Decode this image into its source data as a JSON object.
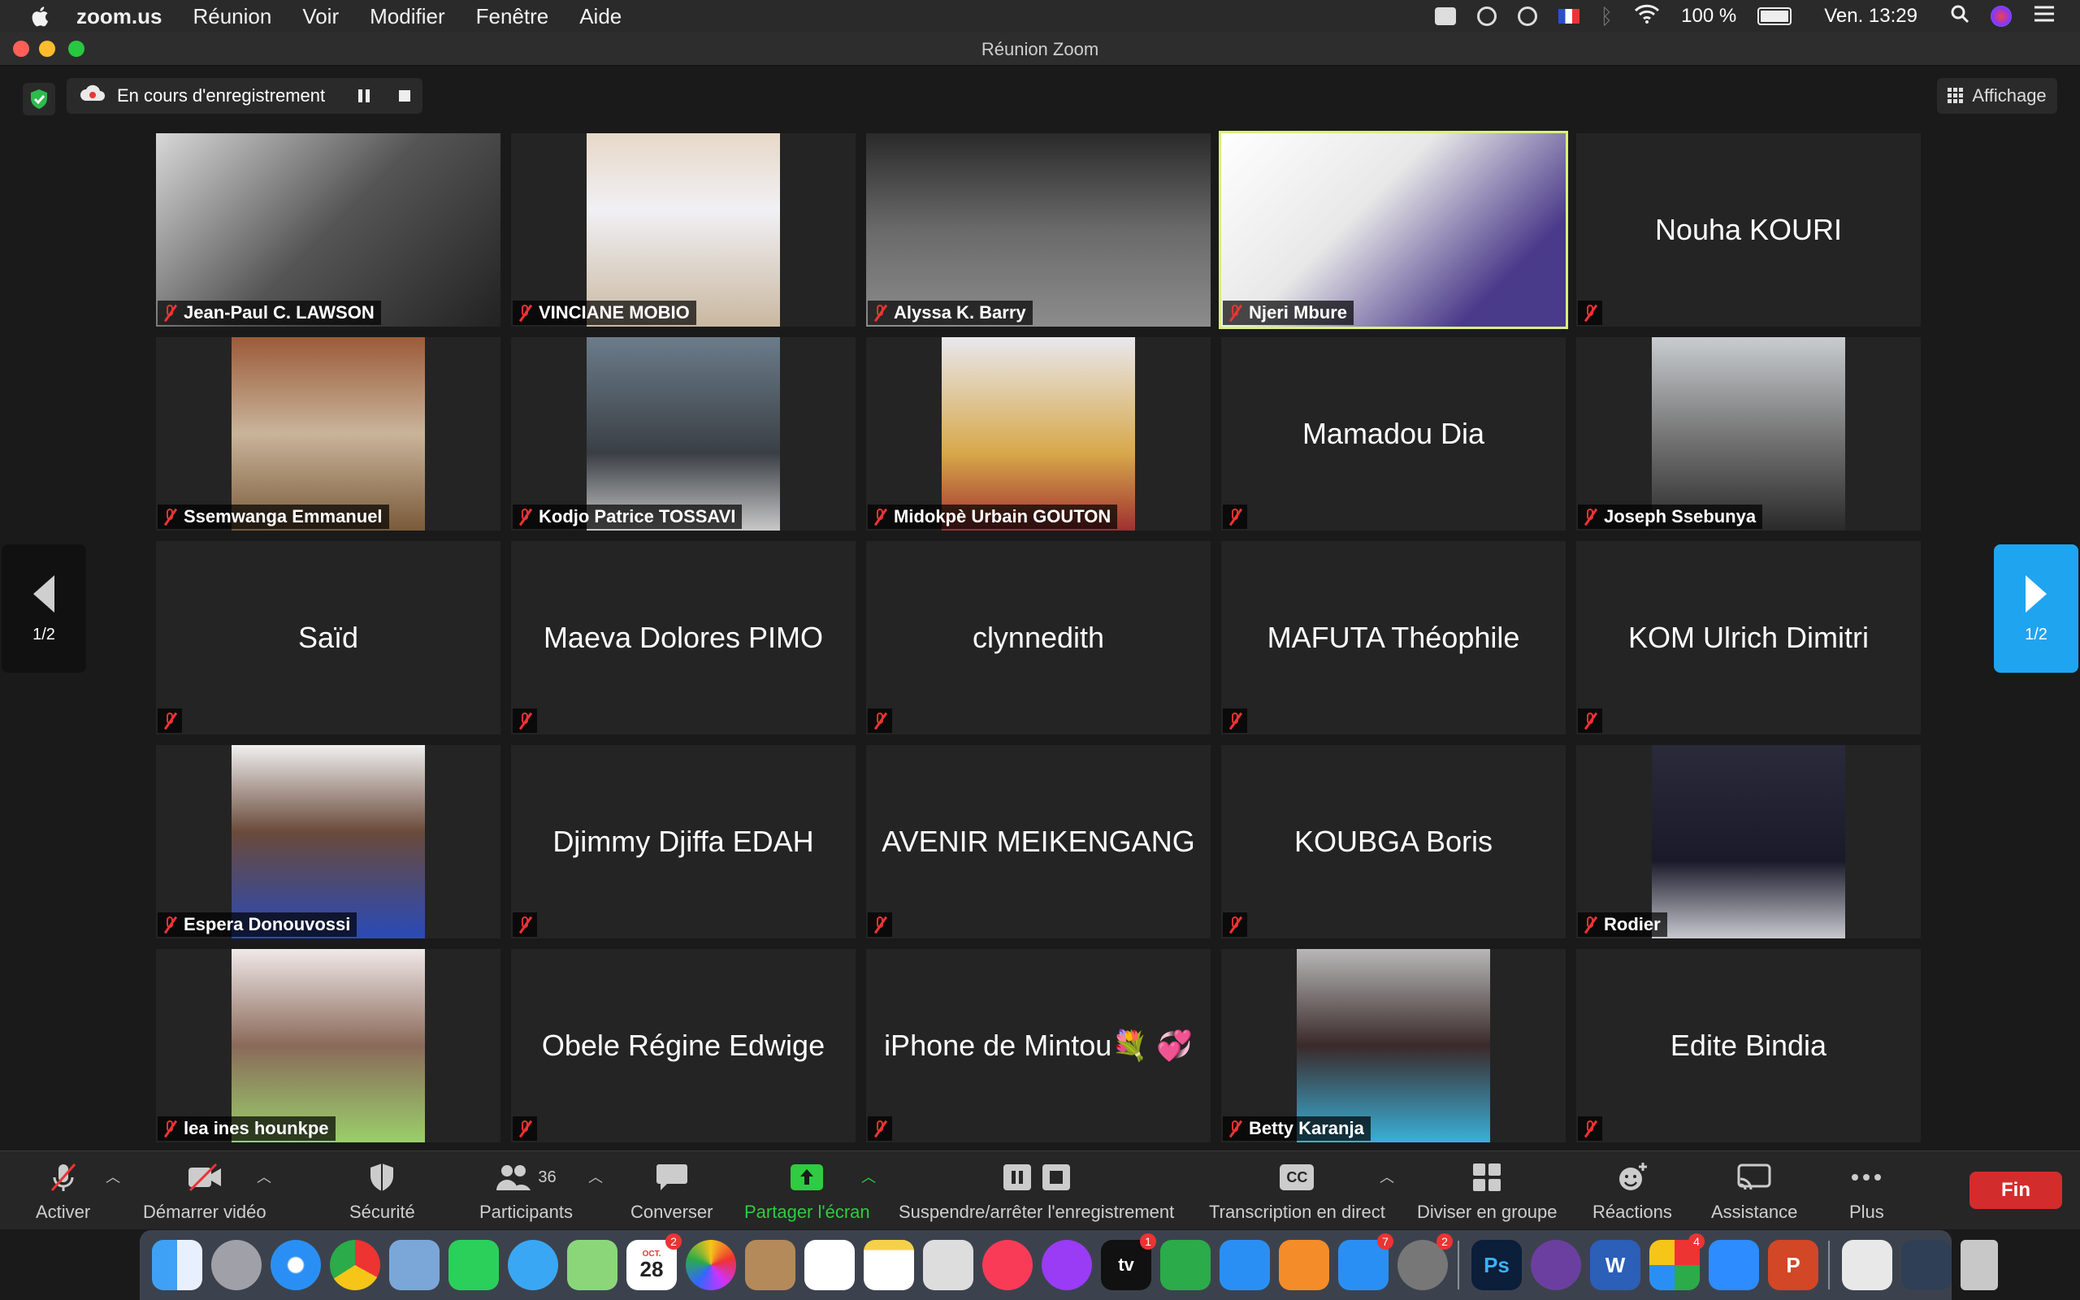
{
  "menubar": {
    "app": "zoom.us",
    "menus": [
      "Réunion",
      "Voir",
      "Modifier",
      "Fenêtre",
      "Aide"
    ],
    "battery": "100 %",
    "clock": "Ven. 13:29"
  },
  "window": {
    "title": "Réunion Zoom"
  },
  "recording": {
    "label": "En cours d'enregistrement"
  },
  "view_button": {
    "label": "Affichage"
  },
  "pager": {
    "prev_label": "1/2",
    "next_label": "1/2"
  },
  "participants": [
    {
      "name": "Jean-Paul C. LAWSON",
      "video": true
    },
    {
      "name": "VINCIANE MOBIO",
      "video": true
    },
    {
      "name": "Alyssa K. Barry",
      "video": true
    },
    {
      "name": "Njeri Mbure",
      "video": true,
      "active": true
    },
    {
      "name": "Nouha KOURI",
      "video": false
    },
    {
      "name": "Ssemwanga Emmanuel",
      "video": true
    },
    {
      "name": "Kodjo Patrice TOSSAVI",
      "video": true
    },
    {
      "name": "Midokpè Urbain GOUTON",
      "video": true
    },
    {
      "name": "Mamadou Dia",
      "video": false
    },
    {
      "name": "Joseph Ssebunya",
      "video": true
    },
    {
      "name": "Saïd",
      "video": false
    },
    {
      "name": "Maeva Dolores PIMO",
      "video": false
    },
    {
      "name": "clynnedith",
      "video": false
    },
    {
      "name": "MAFUTA Théophile",
      "video": false
    },
    {
      "name": "KOM Ulrich Dimitri",
      "video": false
    },
    {
      "name": "Espera Donouvossi",
      "video": true
    },
    {
      "name": "Djimmy Djiffa EDAH",
      "video": false
    },
    {
      "name": "AVENIR MEIKENGANG",
      "video": false
    },
    {
      "name": "KOUBGA Boris",
      "video": false
    },
    {
      "name": "Rodier",
      "video": true
    },
    {
      "name": "lea ines hounkpe",
      "video": true
    },
    {
      "name": "Obele Régine Edwige",
      "video": false
    },
    {
      "name": "iPhone de Mintou💐 💞",
      "video": false
    },
    {
      "name": "Betty Karanja",
      "video": true
    },
    {
      "name": "Edite Bindia",
      "video": false
    }
  ],
  "toolbar": {
    "unmute": "Activer",
    "start_video": "Démarrer vidéo",
    "security": "Sécurité",
    "participants": "Participants",
    "participants_count": "36",
    "chat": "Converser",
    "share": "Partager l'écran",
    "pause_stop_rec": "Suspendre/arrêter l'enregistrement",
    "captions": "Transcription en direct",
    "captions_icon_text": "CC",
    "breakout": "Diviser en groupe",
    "reactions": "Réactions",
    "assist": "Assistance",
    "more": "Plus",
    "end": "Fin"
  },
  "dock": {
    "calendar_month": "OCT.",
    "calendar_day": "28",
    "badges": {
      "calendar": "2",
      "appletv": "1",
      "appstore": "7",
      "settings": "2",
      "office": "4"
    },
    "appletv_label": "tv",
    "ps_label": "Ps",
    "word_label": "W",
    "ppt_label": "P"
  },
  "colors": {
    "active_speaker": "#d9f27a",
    "share_green": "#2ecc40",
    "end_red": "#d32c2c",
    "pager_blue": "#1fa4f0"
  }
}
